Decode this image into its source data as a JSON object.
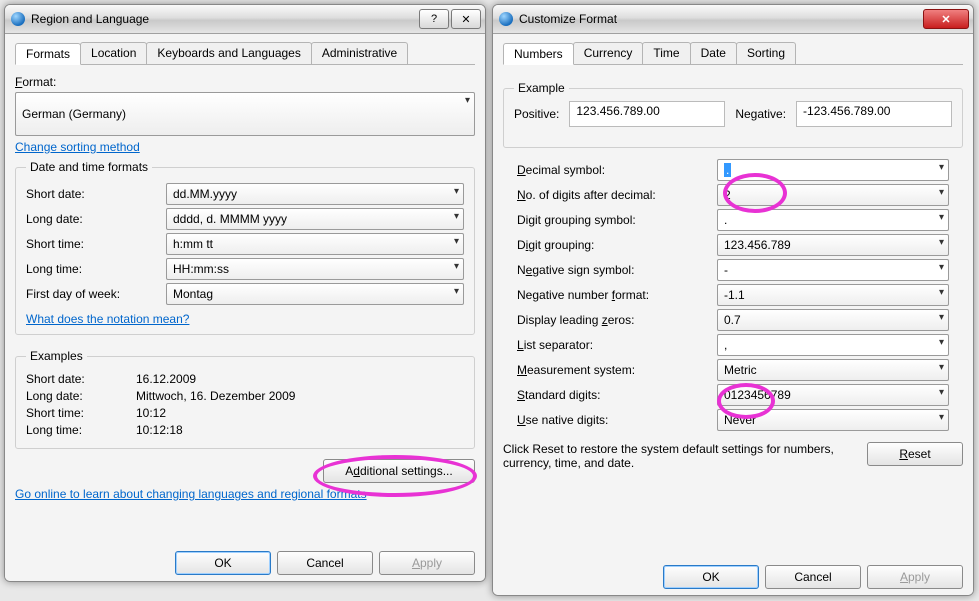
{
  "leftDialog": {
    "title": "Region and Language",
    "tabs": [
      "Formats",
      "Location",
      "Keyboards and Languages",
      "Administrative"
    ],
    "formatLabel": "Format:",
    "formatValue": "German (Germany)",
    "sortingLink": "Change sorting method",
    "dtGroup": "Date and time formats",
    "shortDateLbl": "Short date:",
    "shortDateVal": "dd.MM.yyyy",
    "longDateLbl": "Long date:",
    "longDateVal": "dddd, d. MMMM yyyy",
    "shortTimeLbl": "Short time:",
    "shortTimeVal": "h:mm tt",
    "longTimeLbl": "Long time:",
    "longTimeVal": "HH:mm:ss",
    "firstDayLbl": "First day of week:",
    "firstDayVal": "Montag",
    "notationLink": "What does the notation mean?",
    "examplesGroup": "Examples",
    "exShortDateLbl": "Short date:",
    "exShortDateVal": "16.12.2009",
    "exLongDateLbl": "Long date:",
    "exLongDateVal": "Mittwoch, 16. Dezember 2009",
    "exShortTimeLbl": "Short time:",
    "exShortTimeVal": "10:12",
    "exLongTimeLbl": "Long time:",
    "exLongTimeVal": "10:12:18",
    "additionalBtn": "Additional settings...",
    "onlineLink": "Go online to learn about changing languages and regional formats",
    "ok": "OK",
    "cancel": "Cancel",
    "apply": "Apply"
  },
  "rightDialog": {
    "title": "Customize Format",
    "tabs": [
      "Numbers",
      "Currency",
      "Time",
      "Date",
      "Sorting"
    ],
    "exampleGroup": "Example",
    "positiveLbl": "Positive:",
    "positiveVal": "123.456.789.00",
    "negativeLbl": "Negative:",
    "negativeVal": "-123.456.789.00",
    "decimalSymbolLbl": "Decimal symbol:",
    "decimalSymbolVal": ".",
    "digitsAfterLbl": "No. of digits after decimal:",
    "digitsAfterVal": "2",
    "groupSymbolLbl": "Digit grouping symbol:",
    "groupSymbolVal": ".",
    "groupingLbl": "Digit grouping:",
    "groupingVal": "123.456.789",
    "negSignLbl": "Negative sign symbol:",
    "negSignVal": "-",
    "negFormatLbl": "Negative number format:",
    "negFormatVal": "-1.1",
    "leadZeroLbl": "Display leading zeros:",
    "leadZeroVal": "0.7",
    "listSepLbl": "List separator:",
    "listSepVal": ",",
    "measureLbl": "Measurement system:",
    "measureVal": "Metric",
    "stdDigitsLbl": "Standard digits:",
    "stdDigitsVal": "0123456789",
    "nativeDigitsLbl": "Use native digits:",
    "nativeDigitsVal": "Never",
    "resetText": "Click Reset to restore the system default settings for numbers, currency, time, and date.",
    "resetBtn": "Reset",
    "ok": "OK",
    "cancel": "Cancel",
    "apply": "Apply"
  }
}
